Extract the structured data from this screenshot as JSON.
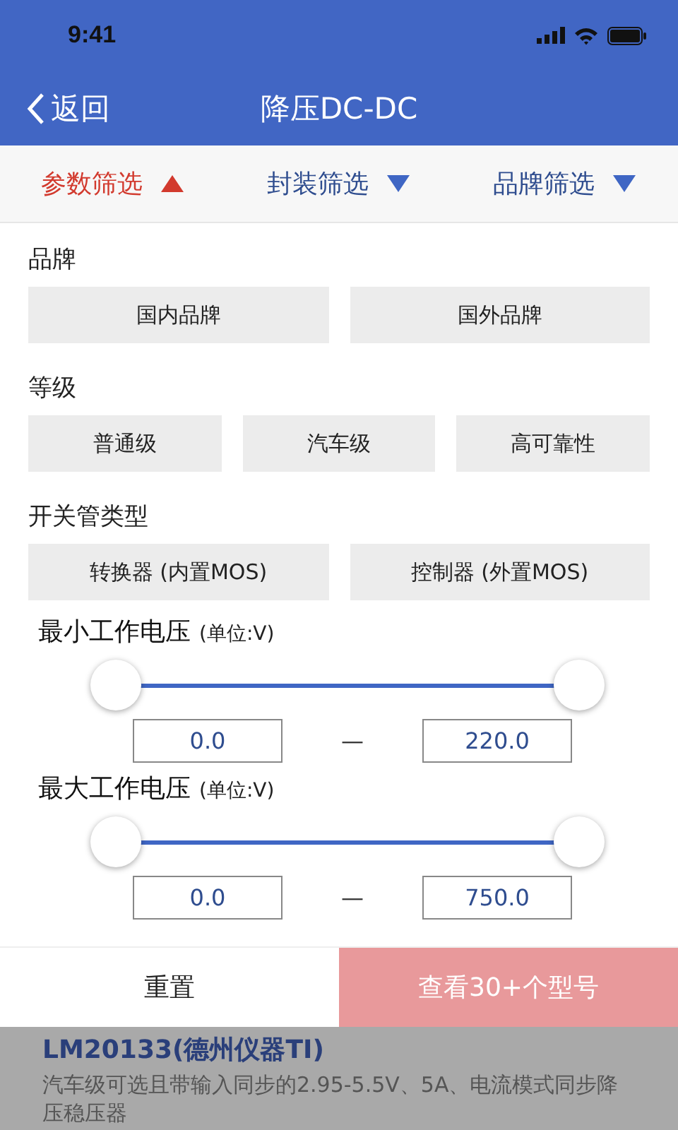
{
  "status_bar": {
    "time": "9:41"
  },
  "nav": {
    "back": "返回",
    "title": "降压DC-DC"
  },
  "filter_tabs": [
    {
      "label": "参数筛选",
      "selected": true
    },
    {
      "label": "封装筛选",
      "selected": false
    },
    {
      "label": "品牌筛选",
      "selected": false
    }
  ],
  "option_groups": [
    {
      "title": "品牌",
      "options": [
        {
          "label": "国内品牌",
          "selected": false
        },
        {
          "label": "国外品牌",
          "selected": false
        }
      ]
    },
    {
      "title": "等级",
      "options": [
        {
          "label": "普通级",
          "selected": false
        },
        {
          "label": "汽车级",
          "selected": false
        },
        {
          "label": "高可靠性",
          "selected": false
        }
      ]
    },
    {
      "title": "开关管类型",
      "options": [
        {
          "label": "转换器 (内置MOS)",
          "selected": false
        },
        {
          "label": "控制器 (外置MOS)",
          "selected": false
        }
      ]
    }
  ],
  "ranges": [
    {
      "title": "最小工作电压",
      "unit": "(单位:V)",
      "thumbs": [
        {
          "level": 0
        },
        {
          "level": 1
        }
      ],
      "min": "0.0",
      "separator": "—",
      "max": "220.0"
    },
    {
      "title": "最大工作电压",
      "unit": "(单位:V)",
      "thumbs": [
        {
          "level": 0
        },
        {
          "level": 1
        }
      ],
      "min": "0.0",
      "separator": "—",
      "max": "750.0"
    }
  ],
  "footer": {
    "reset": "重置",
    "submit": "查看30+个型号",
    "submit_disabled": true
  },
  "results": [
    {
      "title": "LM20133(德州仪器TI)",
      "description": "汽车级可选且带输入同步的2.95-5.5V、5A、电流模式同步降压稳压器"
    }
  ]
}
